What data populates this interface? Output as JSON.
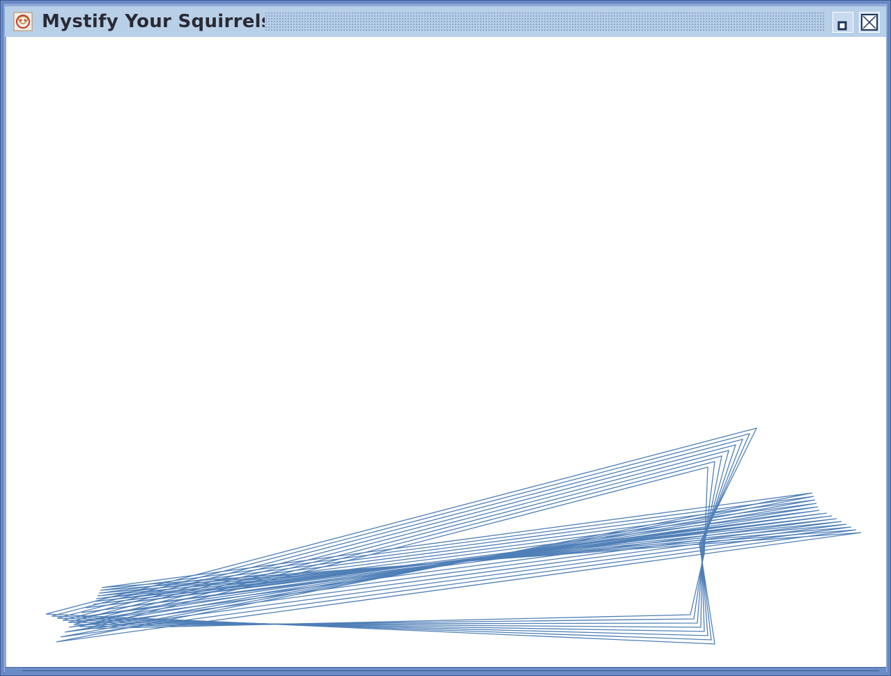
{
  "window": {
    "title": "Mystify Your Squirrels",
    "app_icon": "squirrel-app-icon",
    "controls": {
      "iconify_icon": "iconify-icon",
      "close_icon": "close-icon"
    }
  },
  "colors": {
    "titlebar": "#b8cfe8",
    "frame": "#6b8cc7",
    "line": "#4f7fb7",
    "canvas": "#ffffff"
  }
}
